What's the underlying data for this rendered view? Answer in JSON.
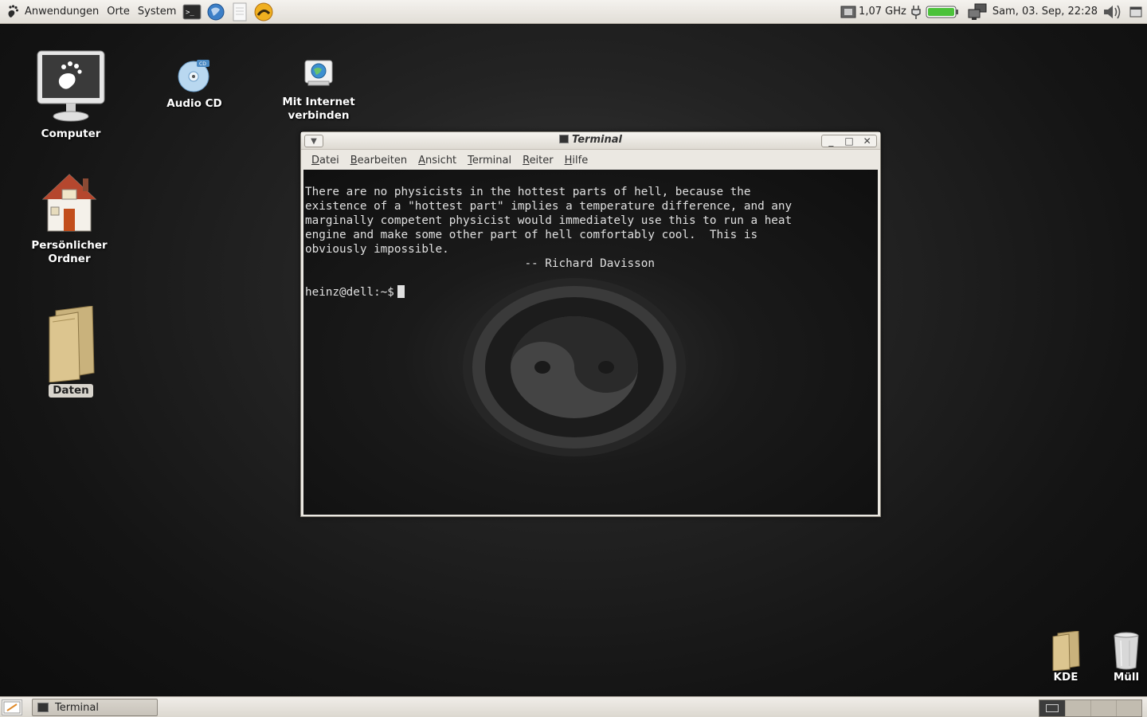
{
  "top_panel": {
    "menus": [
      "Anwendungen",
      "Orte",
      "System"
    ],
    "launchers": [
      "terminal-icon",
      "browser-icon",
      "text-editor-icon",
      "sun-icon"
    ],
    "cpu_freq": "1,07 GHz",
    "clock": "Sam, 03. Sep, 22:28"
  },
  "desktop": {
    "icons": [
      {
        "label": "Computer"
      },
      {
        "label": "Audio CD"
      },
      {
        "label": "Mit Internet verbinden"
      },
      {
        "label": "Persönlicher Ordner"
      },
      {
        "label": "Daten"
      },
      {
        "label": "KDE"
      },
      {
        "label": "Müll"
      }
    ]
  },
  "terminal": {
    "title": "Terminal",
    "menu": [
      "Datei",
      "Bearbeiten",
      "Ansicht",
      "Terminal",
      "Reiter",
      "Hilfe"
    ],
    "lines": [
      "There are no physicists in the hottest parts of hell, because the",
      "existence of a \"hottest part\" implies a temperature difference, and any",
      "marginally competent physicist would immediately use this to run a heat",
      "engine and make some other part of hell comfortably cool.  This is",
      "obviously impossible.",
      "                                -- Richard Davisson",
      ""
    ],
    "prompt": "heinz@dell:~$"
  },
  "bottom_panel": {
    "task_label": "Terminal",
    "workspace_count": 4,
    "active_workspace": 1
  },
  "colors": {
    "panel": "#e6e2dc",
    "desktop_bg": "#1a1a1a",
    "terminal_bg": "#121212",
    "terminal_fg": "#e0e0e0",
    "battery_fill": "#4cc23a"
  }
}
